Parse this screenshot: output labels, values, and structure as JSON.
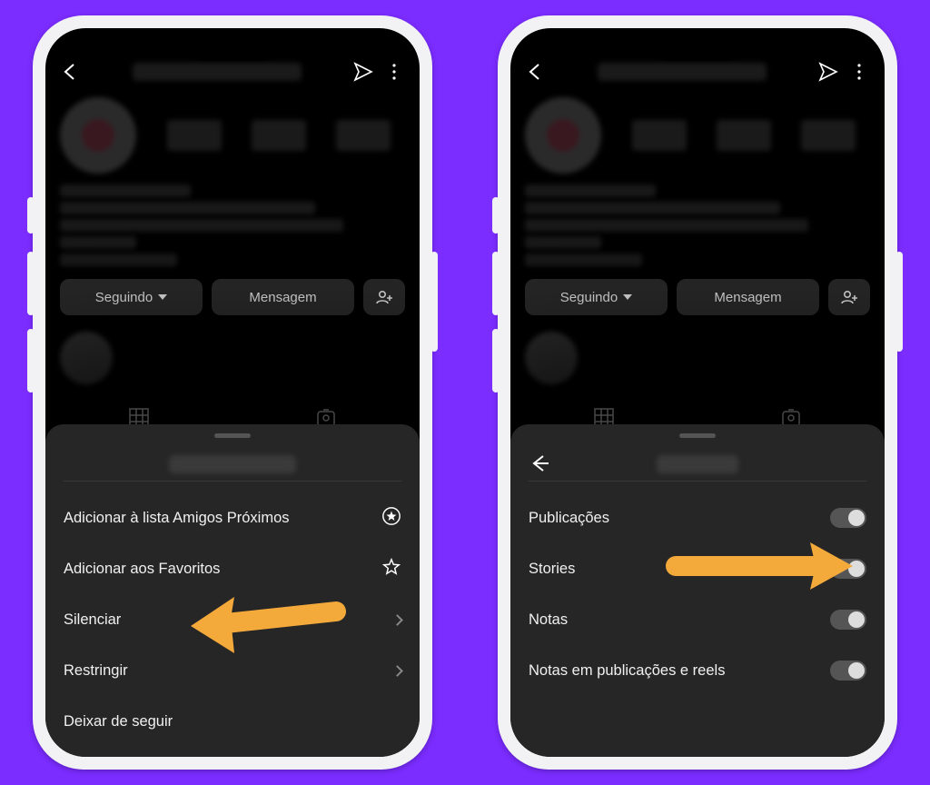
{
  "phones": {
    "left": {
      "buttons": {
        "following": "Seguindo",
        "message": "Mensagem"
      },
      "sheet": {
        "items": {
          "close_friends": "Adicionar à lista Amigos Próximos",
          "favorites": "Adicionar aos Favoritos",
          "mute": "Silenciar",
          "restrict": "Restringir",
          "unfollow": "Deixar de seguir"
        }
      }
    },
    "right": {
      "buttons": {
        "following": "Seguindo",
        "message": "Mensagem"
      },
      "sheet": {
        "items": {
          "posts": "Publicações",
          "stories": "Stories",
          "notes": "Notas",
          "notes_posts_reels": "Notas em publicações e reels"
        }
      }
    }
  }
}
